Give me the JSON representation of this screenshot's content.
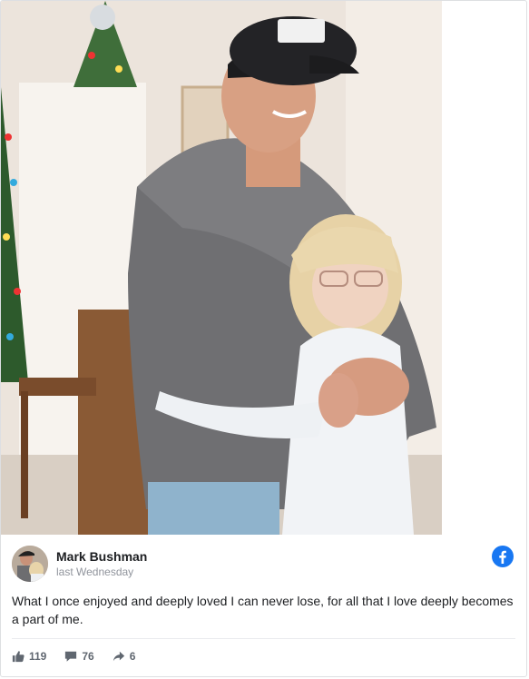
{
  "post": {
    "author": "Mark Bushman",
    "time": "last Wednesday",
    "text": "What I once enjoyed and deeply loved I can never lose, for all that I love deeply becomes a part of me.",
    "likes": "119",
    "comments": "76",
    "shares": "6"
  },
  "colors": {
    "facebook_blue": "#1877f2",
    "meta_gray": "#606770"
  },
  "icons": {
    "platform": "facebook-icon",
    "like": "thumbs-up-icon",
    "comment": "comment-icon",
    "share": "share-arrow-icon"
  }
}
